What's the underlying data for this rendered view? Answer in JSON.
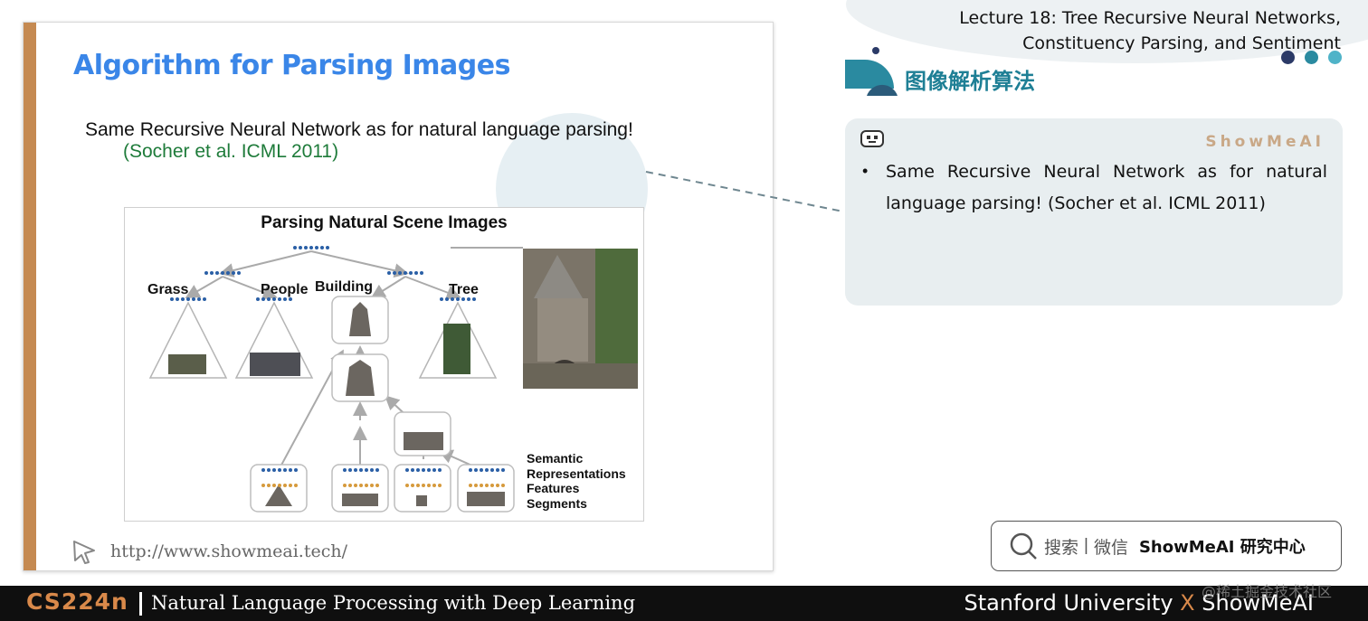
{
  "slide": {
    "title": "Algorithm for Parsing Images",
    "line1": "Same Recursive Neural Network as for natural language parsing!",
    "line2": "(Socher et al. ICML 2011)",
    "url": "http://www.showmeai.tech/",
    "diagram": {
      "title": "Parsing Natural Scene Images",
      "labels": {
        "grass": "Grass",
        "people": "People",
        "building": "Building",
        "tree": "Tree"
      },
      "legend": {
        "semantic": "Semantic",
        "representations": "Representations",
        "features": "Features",
        "segments": "Segments"
      }
    }
  },
  "lecture": {
    "line1": "Lecture 18: Tree Recursive Neural Networks,",
    "line2": "Constituency Parsing, and Sentiment"
  },
  "section": {
    "heading": "图像解析算法"
  },
  "note": {
    "brand": "ShowMeAI",
    "bullet": "•",
    "text": "Same Recursive Neural Network as for natural language parsing! (Socher et al. ICML 2011)"
  },
  "search": {
    "label": "搜索",
    "sep": "|",
    "label2": "微信",
    "brand": "ShowMeAI 研究中心"
  },
  "footer": {
    "course_code": "CS224n",
    "course_name": "Natural Language Processing with Deep Learning",
    "university": "Stanford University",
    "x": "X",
    "brand": "ShowMeAI"
  },
  "watermark": "@稀土掘金技术社区",
  "colors": {
    "title_blue": "#3a86e8",
    "accent_orange": "#c58a52",
    "teal": "#1e7f95",
    "dot_navy": "#2b3a67",
    "dot_teal": "#2a8aa0",
    "dot_light": "#4fb3c8"
  }
}
